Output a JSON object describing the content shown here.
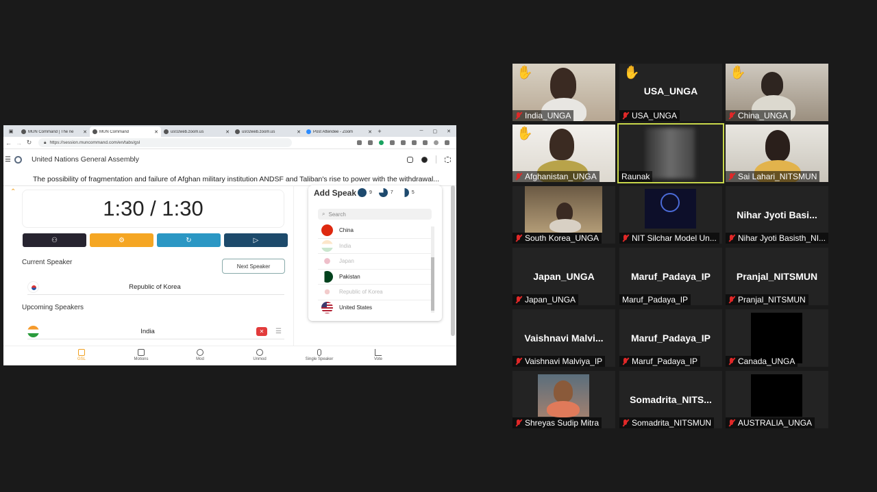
{
  "browser": {
    "tabs": [
      {
        "title": "MUN Command | The ne",
        "active": false
      },
      {
        "title": "MUN Command",
        "active": true
      },
      {
        "title": "us02web.zoom.us",
        "active": false
      },
      {
        "title": "us02web.zoom.us",
        "active": false
      },
      {
        "title": "Post Attendee - Zoom",
        "active": false
      }
    ],
    "url": "https://session.muncommand.com/en/tabs/gsl"
  },
  "app": {
    "committee": "United Nations General Assembly",
    "topic": "The possibility of fragmentation and failure of Afghan military institution ANDSF and Taliban's rise to power with the withdrawal...",
    "timer": "1:30 / 1:30",
    "current_speaker_label": "Current Speaker",
    "next_speaker_label": "Next Speaker",
    "current_speaker": "Republic of Korea",
    "upcoming_label": "Upcoming Speakers",
    "upcoming": [
      "India"
    ],
    "colors": {
      "dark": "#272430",
      "orange": "#f5a623",
      "teal": "#2b97c4",
      "navy": "#1d4a6b",
      "accent": "#f0a020"
    }
  },
  "add_speaker": {
    "title": "Add Speak",
    "stats": [
      "9",
      "7",
      "5"
    ],
    "search_placeholder": "Search",
    "countries": [
      {
        "name": "China",
        "dim": false
      },
      {
        "name": "India",
        "dim": true
      },
      {
        "name": "Japan",
        "dim": true
      },
      {
        "name": "Pakistan",
        "dim": false
      },
      {
        "name": "Republic of Korea",
        "dim": true
      },
      {
        "name": "United States",
        "dim": false
      }
    ]
  },
  "bottom_nav": [
    "GSL",
    "Motions",
    "Mod",
    "Unmod",
    "Single Speaker",
    "Vote"
  ],
  "participants": [
    {
      "name": "India_UNGA",
      "hand": true,
      "video": true
    },
    {
      "name": "USA_UNGA",
      "hand": true,
      "video": false,
      "display": "USA_UNGA"
    },
    {
      "name": "China_UNGA",
      "hand": true,
      "video": true
    },
    {
      "name": "Afghanistan_UNGA",
      "hand": true,
      "video": true
    },
    {
      "name": "Raunak",
      "hand": false,
      "video": true,
      "active": true
    },
    {
      "name": "Sai Lahari_NITSMUN",
      "hand": false,
      "video": true
    },
    {
      "name": "South Korea_UNGA",
      "hand": false,
      "video": true
    },
    {
      "name": "NIT Silchar Model Un...",
      "hand": false,
      "video": true
    },
    {
      "name": "Nihar Jyoti Basisth_NI...",
      "hand": false,
      "video": false,
      "display": "Nihar Jyoti Basi..."
    },
    {
      "name": "Japan_UNGA",
      "hand": false,
      "video": false,
      "display": "Japan_UNGA"
    },
    {
      "name": "Maruf_Padaya_IP",
      "hand": false,
      "video": false,
      "display": "Maruf_Padaya_IP"
    },
    {
      "name": "Pranjal_NITSMUN",
      "hand": false,
      "video": false,
      "display": "Pranjal_NITSMUN"
    },
    {
      "name": "Vaishnavi Malviya_IP",
      "hand": false,
      "video": false,
      "display": "Vaishnavi Malvi..."
    },
    {
      "name": "Maruf_Padaya_IP",
      "hand": false,
      "video": false,
      "display": "Maruf_Padaya_IP"
    },
    {
      "name": "Canada_UNGA",
      "hand": false,
      "video": true
    },
    {
      "name": "Shreyas Sudip Mitra",
      "hand": false,
      "video": true
    },
    {
      "name": "Somadrita_NITSMUN",
      "hand": false,
      "video": false,
      "display": "Somadrita_NITS..."
    },
    {
      "name": "AUSTRALIA_UNGA",
      "hand": false,
      "video": true
    }
  ]
}
